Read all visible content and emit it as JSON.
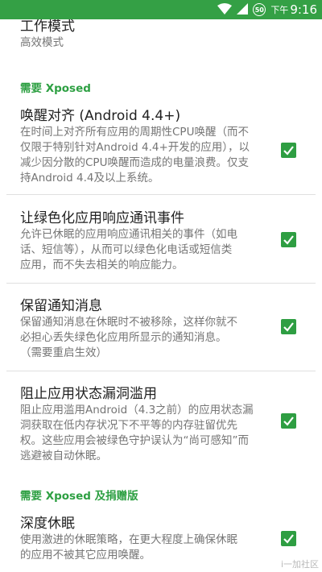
{
  "status_bar": {
    "battery_percent": "50",
    "time_prefix": "下午",
    "time": "9:16",
    "color": "#34a045"
  },
  "work_mode": {
    "title": "工作模式",
    "value": "高效模式"
  },
  "categories": {
    "xposed": "需要 Xposed",
    "xposed_donate": "需要 Xposed 及捐赠版"
  },
  "prefs": [
    {
      "title": "唤醒对齐 (Android 4.4+)",
      "summary": [
        "在时间上对齐所有应用的周期性CPU唤醒（而不",
        "仅限于特别针对Android 4.4+开发的应用），以",
        "减少因分散的CPU唤醒而造成的电量浪费。仅支",
        "持Android 4.4及以上系统。"
      ],
      "checked": true
    },
    {
      "title": "让绿色化应用响应通讯事件",
      "summary": [
        "允许已休眠的应用响应通讯相关的事件（如电",
        "话、短信等），从而可以绿色化电话或短信类",
        "应用，而不失去相关的响应能力。"
      ],
      "checked": true
    },
    {
      "title": "保留通知消息",
      "summary": [
        "保留通知消息在休眠时不被移除，这样你就不",
        "必担心丢失绿色化应用所显示的通知消息。",
        "（需要重启生效）"
      ],
      "checked": true
    },
    {
      "title": "阻止应用状态漏洞滥用",
      "summary": [
        "阻止应用滥用Android（4.3之前）的应用状态漏",
        "洞获取在低内存状况下不平等的内存驻留优先",
        "权。这些应用会被绿色守护误认为“尚可感知”而",
        "逃避被自动休眠。"
      ],
      "checked": true
    },
    {
      "title": "深度休眠",
      "summary": [
        "使用激进的休眠策略，在更大程度上确保休眠",
        "的应用不被其它应用唤醒。"
      ],
      "checked": true
    }
  ],
  "watermark": "i一加社区",
  "accent_color": "#2e9e42"
}
